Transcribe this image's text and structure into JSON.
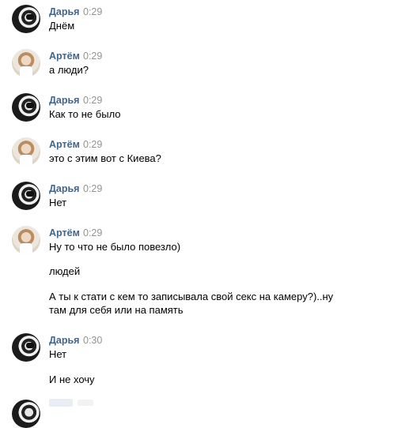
{
  "messages": [
    {
      "author": "Дарья",
      "time": "0:29",
      "avatar": "daria-avatar",
      "lines": [
        "Днём"
      ]
    },
    {
      "author": "Артём",
      "time": "0:29",
      "avatar": "artem-avatar",
      "lines": [
        "а люди?"
      ]
    },
    {
      "author": "Дарья",
      "time": "0:29",
      "avatar": "daria-avatar",
      "lines": [
        "Как то не было"
      ]
    },
    {
      "author": "Артём",
      "time": "0:29",
      "avatar": "artem-avatar",
      "lines": [
        "это с этим вот с Киева?"
      ]
    },
    {
      "author": "Дарья",
      "time": "0:29",
      "avatar": "daria-avatar",
      "lines": [
        "Нет"
      ]
    },
    {
      "author": "Артём",
      "time": "0:29",
      "avatar": "artem-avatar",
      "lines": [
        "Ну то что не было повезло)",
        "людей",
        "А ты к стати с кем то записывала свой секс на камеру?)..ну",
        "там для себя или на память"
      ]
    },
    {
      "author": "Дарья",
      "time": "0:30",
      "avatar": "daria-avatar",
      "lines": [
        "Нет",
        "И не хочу"
      ]
    }
  ]
}
